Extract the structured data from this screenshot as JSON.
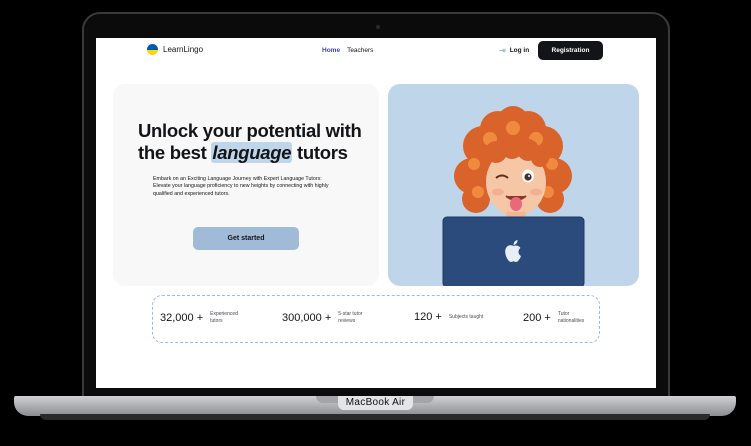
{
  "device": {
    "model_label": "MacBook Air"
  },
  "header": {
    "logo_text": "LearnLingo",
    "nav": [
      {
        "label": "Home",
        "active": true
      },
      {
        "label": "Teachers",
        "active": false
      }
    ],
    "login_label": "Log in",
    "registration_label": "Registration"
  },
  "hero": {
    "title_before": "Unlock your potential with the best ",
    "title_highlight": "language",
    "title_after": " tutors",
    "description": "Embark on an Exciting Language Journey with Expert Language Tutors: Elevate your language proficiency to new heights by connecting with highly qualified and experienced tutors.",
    "cta_label": "Get started"
  },
  "stats": [
    {
      "value": "32,000 +",
      "label": "Experienced tutors"
    },
    {
      "value": "300,000 +",
      "label": "5-star tutor reviews"
    },
    {
      "value": "120 +",
      "label": "Subjects taught"
    },
    {
      "value": "200 +",
      "label": "Tutor nationalities"
    }
  ],
  "colors": {
    "accent": "#9fbbd8",
    "accent_light": "#bfd6ea",
    "nav_active": "#3b3fd6",
    "dark": "#121417",
    "flag_blue": "#0057b8",
    "flag_yellow": "#ffd700",
    "laptop_blue": "#2a4b7c"
  },
  "icons": {
    "login": "login-arrow-icon",
    "laptop_logo": "apple-logo-icon"
  }
}
